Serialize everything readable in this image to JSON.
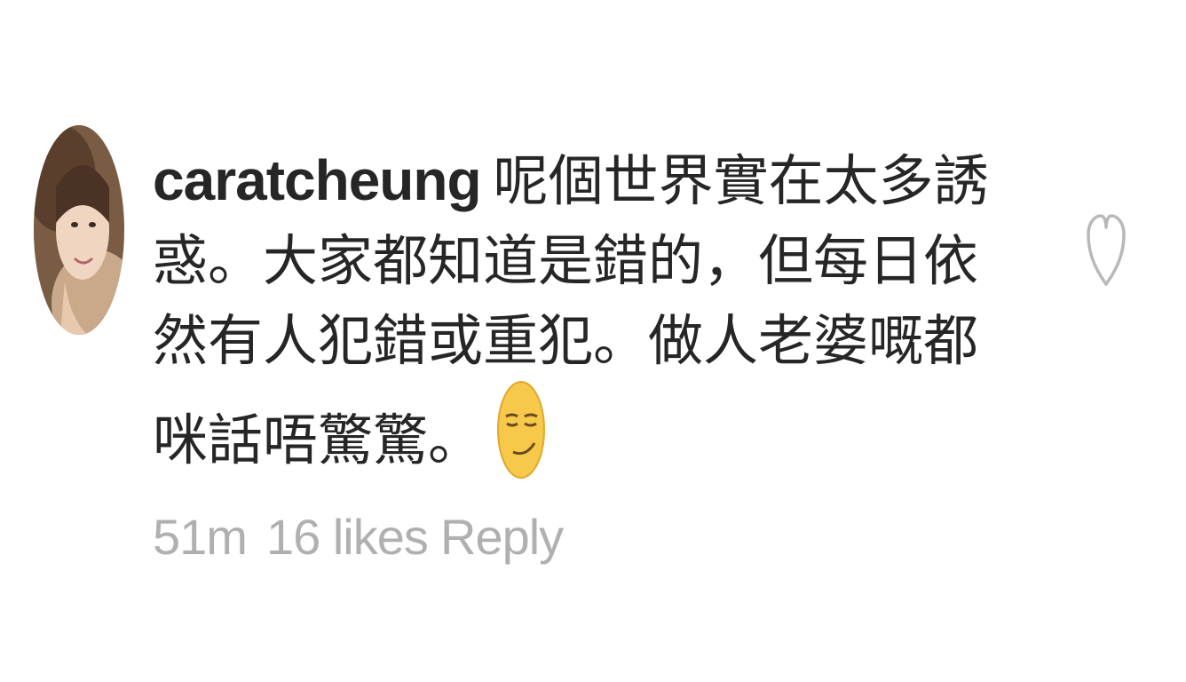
{
  "comment": {
    "username": "caratcheung",
    "text": "呢個世界實在太多誘惑。大家都知道是錯的，但每日依然有人犯錯或重犯。做人老婆嘅都咪話唔驚驚。",
    "emoji": "smirking-face-icon",
    "time": "51m",
    "likes": "16 likes",
    "reply": "Reply"
  },
  "colors": {
    "text": "#262626",
    "meta": "#b0b0b0",
    "heart": "#b8b8b8"
  },
  "icons": {
    "like": "heart-outline-icon"
  }
}
